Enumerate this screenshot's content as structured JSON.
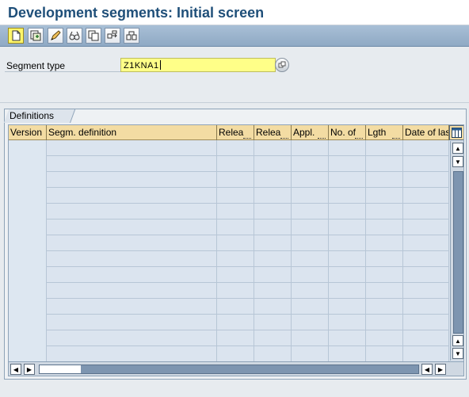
{
  "title": "Development segments: Initial screen",
  "toolbar": {
    "buttons": [
      "create-icon",
      "copy-create-icon",
      "edit-icon",
      "display-icon",
      "copy-icon",
      "transport-icon",
      "convert-icon"
    ]
  },
  "segment": {
    "label": "Segment type",
    "value": "Z1KNA1"
  },
  "group": {
    "title": "Definitions"
  },
  "table": {
    "columns": [
      "Version",
      "Segm. definition",
      "Relea",
      "Relea",
      "Appl.",
      "No. of",
      "Lgth",
      "Date of las"
    ],
    "row_count": 14
  },
  "colors": {
    "title": "#1f4f79",
    "toolbar": "#9fb6cf",
    "input_highlight": "#ffff88",
    "table_header": "#f3dca3",
    "table_body": "#dbe4ef"
  }
}
